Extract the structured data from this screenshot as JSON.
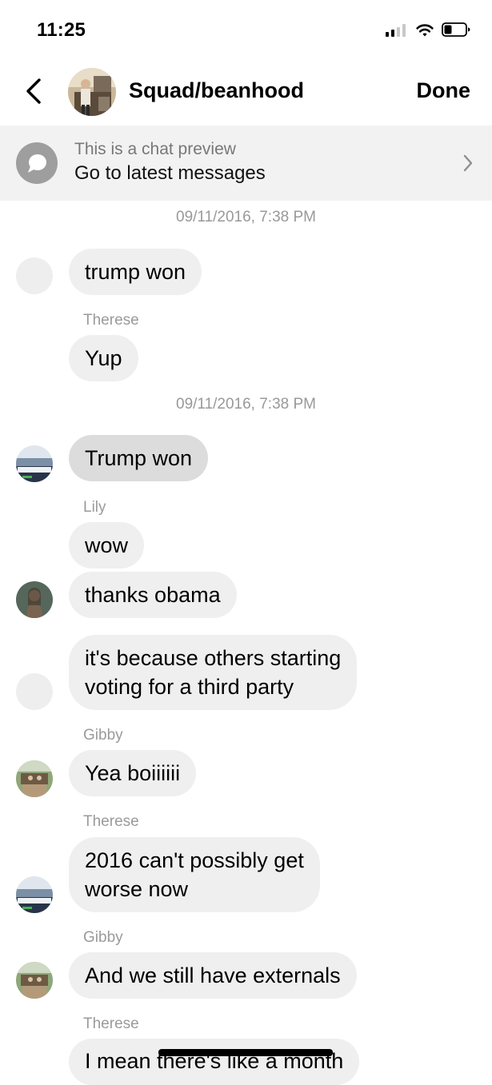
{
  "status_bar": {
    "time": "11:25"
  },
  "header": {
    "title": "Squad/beanhood",
    "done_label": "Done"
  },
  "preview_banner": {
    "line1": "This is a chat preview",
    "line2": "Go to latest messages"
  },
  "messages": {
    "ts1": "09/11/2016, 7:38 PM",
    "m1": "trump won",
    "s1": "Therese",
    "m2": "Yup",
    "ts2": "09/11/2016, 7:38 PM",
    "m3": "Trump won",
    "s2": "Lily",
    "m4": "wow",
    "m5": "thanks obama",
    "m6_l1": "it's because others starting",
    "m6_l2": "voting for a third party",
    "s3": "Gibby",
    "m7": "Yea boiiiiii",
    "s4": "Therese",
    "m8_l1": "2016 can't possibly get",
    "m8_l2": "worse now",
    "s5": "Gibby",
    "m9": "And we still have externals",
    "s6": "Therese",
    "m10": "I mean there's like  a month"
  },
  "icons": {
    "back": "chevron-left-icon",
    "preview": "chat-bubble-icon",
    "chevron": "chevron-right-icon",
    "signal": "cellular-signal-icon",
    "wifi": "wifi-icon",
    "battery": "battery-icon"
  }
}
